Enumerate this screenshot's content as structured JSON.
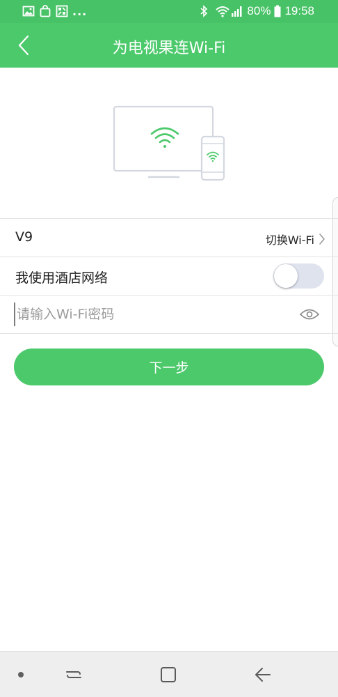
{
  "status_bar": {
    "time": "19:58",
    "battery": "80%",
    "overflow": "...",
    "left_icons": [
      "image-icon",
      "bag-icon",
      "grid-icon"
    ],
    "right_icons": [
      "bluetooth-icon",
      "wifi-icon",
      "signal-icon",
      "battery-icon"
    ]
  },
  "app_bar": {
    "title": "为电视果连Wi-Fi",
    "back_icon": "back-icon"
  },
  "illustration": {
    "icons": [
      "tv-icon",
      "phone-icon",
      "wifi-icon"
    ],
    "accent_color": "#4cc96b"
  },
  "network": {
    "ssid": "V9",
    "switch_label": "切换Wi-Fi"
  },
  "hotel": {
    "label": "我使用酒店网络",
    "enabled": false
  },
  "password": {
    "value": "",
    "placeholder": "请输入Wi-Fi密码",
    "toggle_icon": "eye-icon"
  },
  "next_button": {
    "label": "下一步"
  },
  "nav_bar": {
    "icons": [
      "dot-icon",
      "recent-apps-icon",
      "home-icon",
      "back-icon"
    ]
  },
  "colors": {
    "status_bar": "#48c267",
    "primary": "#4cc96b",
    "toggle_track": "#dfe3ee",
    "divider": "#e4e4e4",
    "nav_bar": "#eeeeee"
  }
}
